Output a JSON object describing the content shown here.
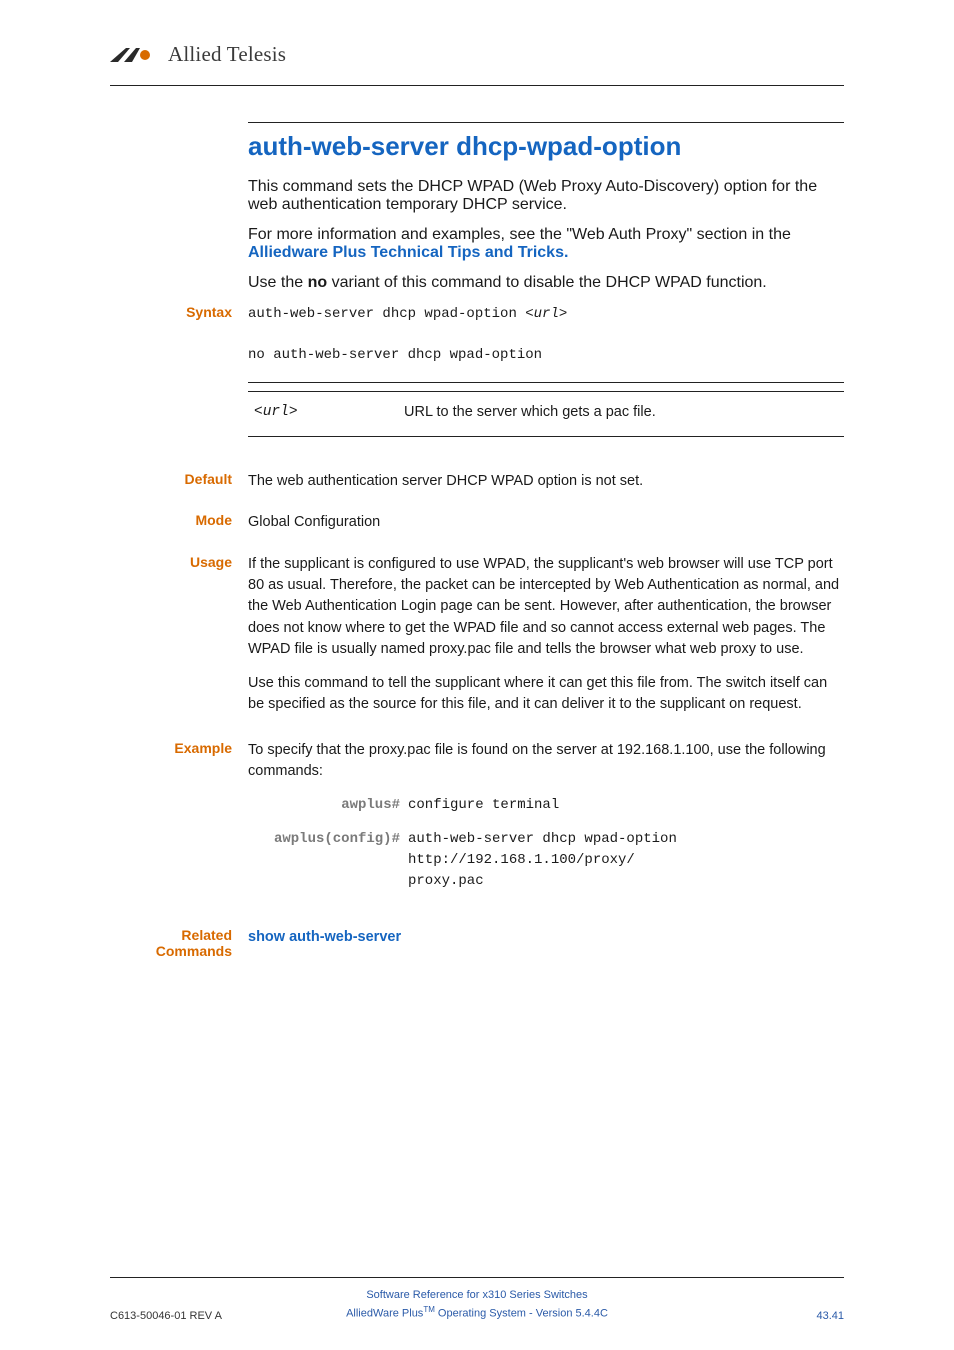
{
  "header": {
    "brand": "Allied Telesis"
  },
  "title": "auth-web-server dhcp-wpad-option",
  "intro": {
    "p1": "This command sets the DHCP WPAD (Web Proxy Auto-Discovery) option for the web authentication temporary DHCP service.",
    "p2_pre": "For more information and examples, see the \"Web Auth Proxy\" section in the ",
    "p2_link": "Alliedware Plus Technical Tips and Tricks.",
    "p3_pre": "Use the ",
    "p3_bold": "no",
    "p3_post": " variant of this command to disable the DHCP WPAD function."
  },
  "labels": {
    "syntax": "Syntax",
    "default": "Default",
    "mode": "Mode",
    "usage": "Usage",
    "example": "Example",
    "related": "Related Commands"
  },
  "syntax": {
    "line1_pre": "auth-web-server dhcp wpad-option <",
    "line1_ital": "url",
    "line1_post": ">",
    "line2": "no auth-web-server dhcp wpad-option"
  },
  "param": {
    "name_pre": "<",
    "name_ital": "url",
    "name_post": ">",
    "desc": "URL to the server which gets a pac file."
  },
  "default_text": "The web authentication server DHCP WPAD option is not set.",
  "mode_text": "Global Configuration",
  "usage": {
    "p1": "If the supplicant is configured to use WPAD, the supplicant's web browser will use TCP port 80 as usual. Therefore, the packet can be intercepted by Web Authentication as normal, and the Web Authentication Login page can be sent. However, after authentication, the browser does not know where to get the WPAD file and so cannot access external web pages. The WPAD file is usually named proxy.pac file and tells the browser what web proxy to use.",
    "p2": "Use this command to tell the supplicant where it can get this file from. The switch itself can be specified as the source for this file, and it can deliver it to the supplicant on request."
  },
  "example_intro": "To specify that the proxy.pac file is found on the server at 192.168.1.100, use the following commands:",
  "example": {
    "rows": [
      {
        "prompt": "awplus#",
        "cmd": "configure terminal"
      },
      {
        "prompt": "awplus(config)#",
        "cmd": "auth-web-server dhcp wpad-option http://192.168.1.100/proxy/\nproxy.pac"
      }
    ]
  },
  "related_link": "show auth-web-server",
  "footer": {
    "left": "C613-50046-01 REV A",
    "center_l1": "Software Reference for x310 Series Switches",
    "center_l2_pre": "AlliedWare Plus",
    "center_l2_tm": "TM",
    "center_l2_post": " Operating System - Version 5.4.4C",
    "right": "43.41"
  }
}
